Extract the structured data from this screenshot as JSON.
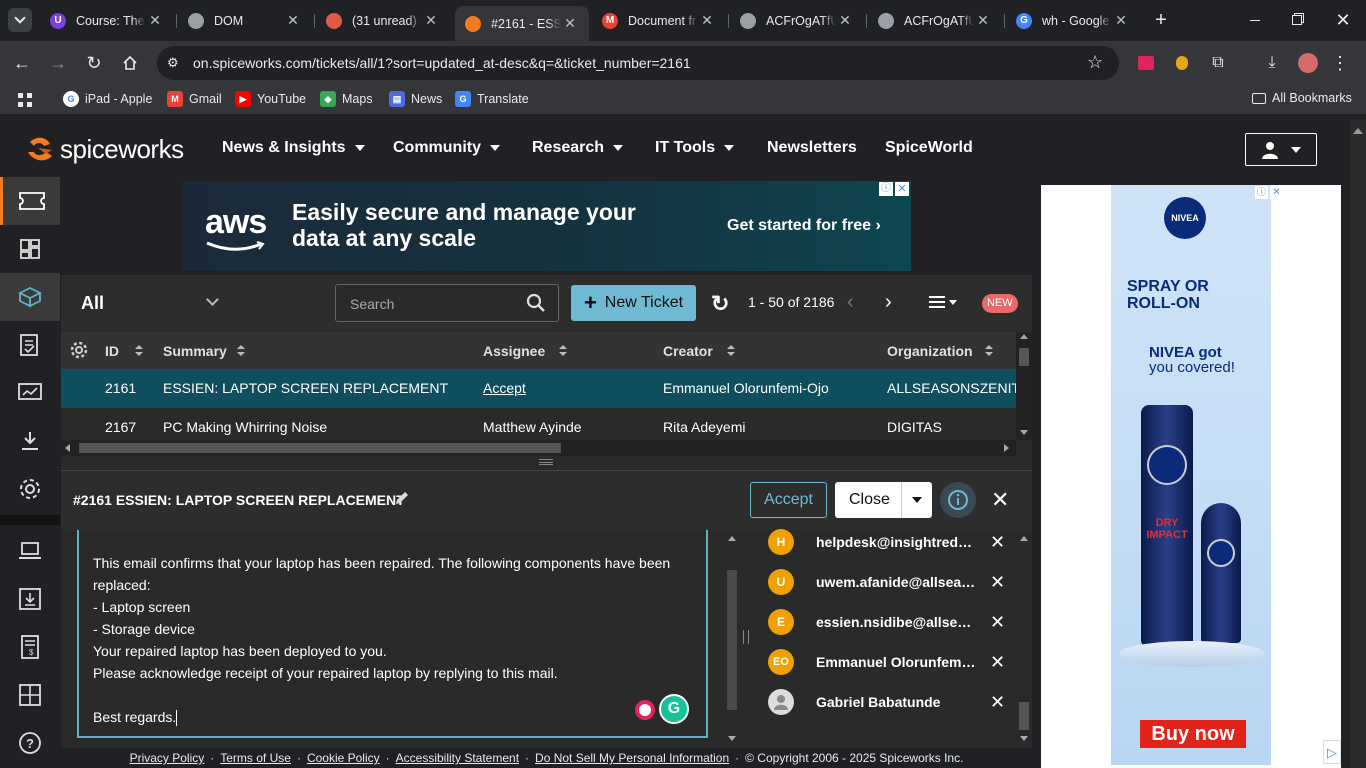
{
  "browser": {
    "tabs": [
      {
        "title": "Course: The C",
        "icon": "course-icon",
        "color": "#7b3fe4",
        "glyph": "U"
      },
      {
        "title": "DOM",
        "icon": "globe-icon",
        "color": "#9aa0a6",
        "glyph": ""
      },
      {
        "title": "(31 unread) -",
        "icon": "mail-icon",
        "color": "#e05a47",
        "glyph": ""
      },
      {
        "title": "#2161 - ESSI",
        "icon": "spiceworks-icon",
        "color": "#f47b20",
        "glyph": ""
      },
      {
        "title": "Document fr",
        "icon": "gmail-icon",
        "color": "#ea4335",
        "glyph": "M"
      },
      {
        "title": "ACFrOgATfU",
        "icon": "globe-icon",
        "color": "#9aa0a6",
        "glyph": ""
      },
      {
        "title": "ACFrOgATfU",
        "icon": "globe-icon",
        "color": "#9aa0a6",
        "glyph": ""
      },
      {
        "title": "wh - Google",
        "icon": "google-icon",
        "color": "#4285f4",
        "glyph": "G"
      }
    ],
    "url": "on.spiceworks.com/tickets/all/1?sort=updated_at-desc&q=&ticket_number=2161",
    "bookmarks": [
      {
        "label": "iPad - Apple",
        "icon": "google-icon"
      },
      {
        "label": "Gmail",
        "icon": "gmail-icon"
      },
      {
        "label": "YouTube",
        "icon": "youtube-icon"
      },
      {
        "label": "Maps",
        "icon": "maps-icon"
      },
      {
        "label": "News",
        "icon": "news-icon"
      },
      {
        "label": "Translate",
        "icon": "translate-icon"
      }
    ],
    "all_bookmarks": "All Bookmarks"
  },
  "site": {
    "logo": "spiceworks",
    "nav": [
      {
        "label": "News & Insights",
        "dropdown": true
      },
      {
        "label": "Community",
        "dropdown": true
      },
      {
        "label": "Research",
        "dropdown": true
      },
      {
        "label": "IT Tools",
        "dropdown": true
      },
      {
        "label": "Newsletters",
        "dropdown": false
      },
      {
        "label": "SpiceWorld",
        "dropdown": false
      }
    ]
  },
  "ad_banner": {
    "brand": "aws",
    "headline_line1": "Easily secure and manage your",
    "headline_line2": "data at any scale",
    "cta": "Get started for free ›"
  },
  "tickets": {
    "view": "All",
    "search_placeholder": "Search",
    "new_ticket": "New Ticket",
    "pagination": "1 - 50 of 2186",
    "new_badge": "NEW",
    "columns": [
      "ID",
      "Summary",
      "Assignee",
      "Creator",
      "Organization"
    ],
    "rows": [
      {
        "id": "2161",
        "summary": "ESSIEN: LAPTOP SCREEN REPLACEMENT",
        "assignee": "Accept",
        "creator": "Emmanuel Olorunfemi-Ojo",
        "organization": "ALLSEASONSZENITH"
      },
      {
        "id": "2167",
        "summary": "PC Making Whirring Noise",
        "assignee": "Matthew Ayinde",
        "creator": "Rita Adeyemi",
        "organization": "DIGITAS"
      }
    ]
  },
  "detail": {
    "title": "#2161 ESSIEN: LAPTOP SCREEN REPLACEMENT",
    "accept": "Accept",
    "close": "Close",
    "email_lines": [
      "This email confirms that your laptop has been repaired. The following components have been replaced:",
      "- Laptop screen",
      "- Storage device",
      "Your repaired laptop has been deployed to you.",
      "Please acknowledge receipt of your repaired laptop by replying to this mail.",
      "",
      "Best regards."
    ],
    "watchers": [
      {
        "initials": "H",
        "name": "helpdesk@insightredefi..."
      },
      {
        "initials": "U",
        "name": "uwem.afanide@allseas..."
      },
      {
        "initials": "E",
        "name": "essien.nsidibe@allseas..."
      },
      {
        "initials": "EO",
        "name": "Emmanuel Olorunfemi-..."
      },
      {
        "initials": "",
        "name": "Gabriel Babatunde"
      }
    ]
  },
  "footer": {
    "links": [
      "Privacy Policy",
      "Terms of Use",
      "Cookie Policy",
      "Accessibility Statement",
      "Do Not Sell My Personal Information"
    ],
    "copyright": "© Copyright 2006 - 2025 Spiceworks Inc."
  },
  "right_ad": {
    "brand": "NIVEA",
    "line1": "SPRAY OR",
    "line2": "ROLL-ON",
    "tagline1": "NIVEA got",
    "tagline2": "you covered!",
    "product": "DRY IMPACT",
    "cta": "Buy now"
  }
}
